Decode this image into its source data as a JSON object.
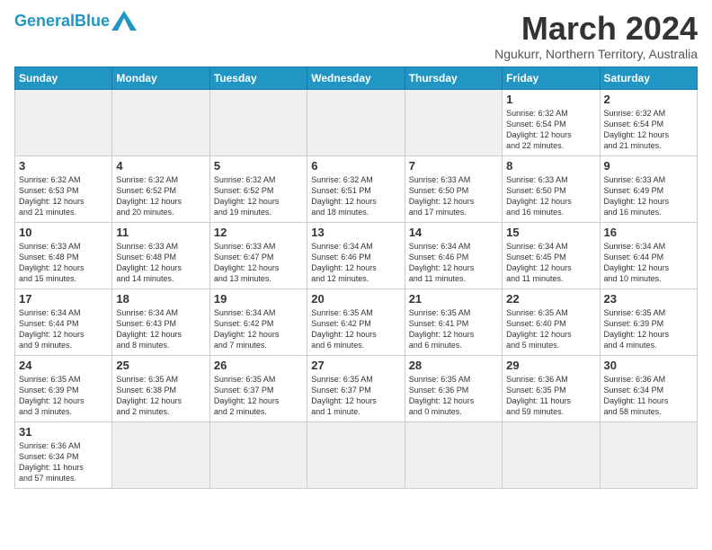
{
  "header": {
    "logo_general": "General",
    "logo_blue": "Blue",
    "month_title": "March 2024",
    "subtitle": "Ngukurr, Northern Territory, Australia"
  },
  "days_of_week": [
    "Sunday",
    "Monday",
    "Tuesday",
    "Wednesday",
    "Thursday",
    "Friday",
    "Saturday"
  ],
  "weeks": [
    [
      {
        "day": "",
        "info": "",
        "empty": true
      },
      {
        "day": "",
        "info": "",
        "empty": true
      },
      {
        "day": "",
        "info": "",
        "empty": true
      },
      {
        "day": "",
        "info": "",
        "empty": true
      },
      {
        "day": "",
        "info": "",
        "empty": true
      },
      {
        "day": "1",
        "info": "Sunrise: 6:32 AM\nSunset: 6:54 PM\nDaylight: 12 hours\nand 22 minutes."
      },
      {
        "day": "2",
        "info": "Sunrise: 6:32 AM\nSunset: 6:54 PM\nDaylight: 12 hours\nand 21 minutes."
      }
    ],
    [
      {
        "day": "3",
        "info": "Sunrise: 6:32 AM\nSunset: 6:53 PM\nDaylight: 12 hours\nand 21 minutes."
      },
      {
        "day": "4",
        "info": "Sunrise: 6:32 AM\nSunset: 6:52 PM\nDaylight: 12 hours\nand 20 minutes."
      },
      {
        "day": "5",
        "info": "Sunrise: 6:32 AM\nSunset: 6:52 PM\nDaylight: 12 hours\nand 19 minutes."
      },
      {
        "day": "6",
        "info": "Sunrise: 6:32 AM\nSunset: 6:51 PM\nDaylight: 12 hours\nand 18 minutes."
      },
      {
        "day": "7",
        "info": "Sunrise: 6:33 AM\nSunset: 6:50 PM\nDaylight: 12 hours\nand 17 minutes."
      },
      {
        "day": "8",
        "info": "Sunrise: 6:33 AM\nSunset: 6:50 PM\nDaylight: 12 hours\nand 16 minutes."
      },
      {
        "day": "9",
        "info": "Sunrise: 6:33 AM\nSunset: 6:49 PM\nDaylight: 12 hours\nand 16 minutes."
      }
    ],
    [
      {
        "day": "10",
        "info": "Sunrise: 6:33 AM\nSunset: 6:48 PM\nDaylight: 12 hours\nand 15 minutes."
      },
      {
        "day": "11",
        "info": "Sunrise: 6:33 AM\nSunset: 6:48 PM\nDaylight: 12 hours\nand 14 minutes."
      },
      {
        "day": "12",
        "info": "Sunrise: 6:33 AM\nSunset: 6:47 PM\nDaylight: 12 hours\nand 13 minutes."
      },
      {
        "day": "13",
        "info": "Sunrise: 6:34 AM\nSunset: 6:46 PM\nDaylight: 12 hours\nand 12 minutes."
      },
      {
        "day": "14",
        "info": "Sunrise: 6:34 AM\nSunset: 6:46 PM\nDaylight: 12 hours\nand 11 minutes."
      },
      {
        "day": "15",
        "info": "Sunrise: 6:34 AM\nSunset: 6:45 PM\nDaylight: 12 hours\nand 11 minutes."
      },
      {
        "day": "16",
        "info": "Sunrise: 6:34 AM\nSunset: 6:44 PM\nDaylight: 12 hours\nand 10 minutes."
      }
    ],
    [
      {
        "day": "17",
        "info": "Sunrise: 6:34 AM\nSunset: 6:44 PM\nDaylight: 12 hours\nand 9 minutes."
      },
      {
        "day": "18",
        "info": "Sunrise: 6:34 AM\nSunset: 6:43 PM\nDaylight: 12 hours\nand 8 minutes."
      },
      {
        "day": "19",
        "info": "Sunrise: 6:34 AM\nSunset: 6:42 PM\nDaylight: 12 hours\nand 7 minutes."
      },
      {
        "day": "20",
        "info": "Sunrise: 6:35 AM\nSunset: 6:42 PM\nDaylight: 12 hours\nand 6 minutes."
      },
      {
        "day": "21",
        "info": "Sunrise: 6:35 AM\nSunset: 6:41 PM\nDaylight: 12 hours\nand 6 minutes."
      },
      {
        "day": "22",
        "info": "Sunrise: 6:35 AM\nSunset: 6:40 PM\nDaylight: 12 hours\nand 5 minutes."
      },
      {
        "day": "23",
        "info": "Sunrise: 6:35 AM\nSunset: 6:39 PM\nDaylight: 12 hours\nand 4 minutes."
      }
    ],
    [
      {
        "day": "24",
        "info": "Sunrise: 6:35 AM\nSunset: 6:39 PM\nDaylight: 12 hours\nand 3 minutes."
      },
      {
        "day": "25",
        "info": "Sunrise: 6:35 AM\nSunset: 6:38 PM\nDaylight: 12 hours\nand 2 minutes."
      },
      {
        "day": "26",
        "info": "Sunrise: 6:35 AM\nSunset: 6:37 PM\nDaylight: 12 hours\nand 2 minutes."
      },
      {
        "day": "27",
        "info": "Sunrise: 6:35 AM\nSunset: 6:37 PM\nDaylight: 12 hours\nand 1 minute."
      },
      {
        "day": "28",
        "info": "Sunrise: 6:35 AM\nSunset: 6:36 PM\nDaylight: 12 hours\nand 0 minutes."
      },
      {
        "day": "29",
        "info": "Sunrise: 6:36 AM\nSunset: 6:35 PM\nDaylight: 11 hours\nand 59 minutes."
      },
      {
        "day": "30",
        "info": "Sunrise: 6:36 AM\nSunset: 6:34 PM\nDaylight: 11 hours\nand 58 minutes."
      }
    ],
    [
      {
        "day": "31",
        "info": "Sunrise: 6:36 AM\nSunset: 6:34 PM\nDaylight: 11 hours\nand 57 minutes."
      },
      {
        "day": "",
        "info": "",
        "empty": true
      },
      {
        "day": "",
        "info": "",
        "empty": true
      },
      {
        "day": "",
        "info": "",
        "empty": true
      },
      {
        "day": "",
        "info": "",
        "empty": true
      },
      {
        "day": "",
        "info": "",
        "empty": true
      },
      {
        "day": "",
        "info": "",
        "empty": true
      }
    ]
  ]
}
